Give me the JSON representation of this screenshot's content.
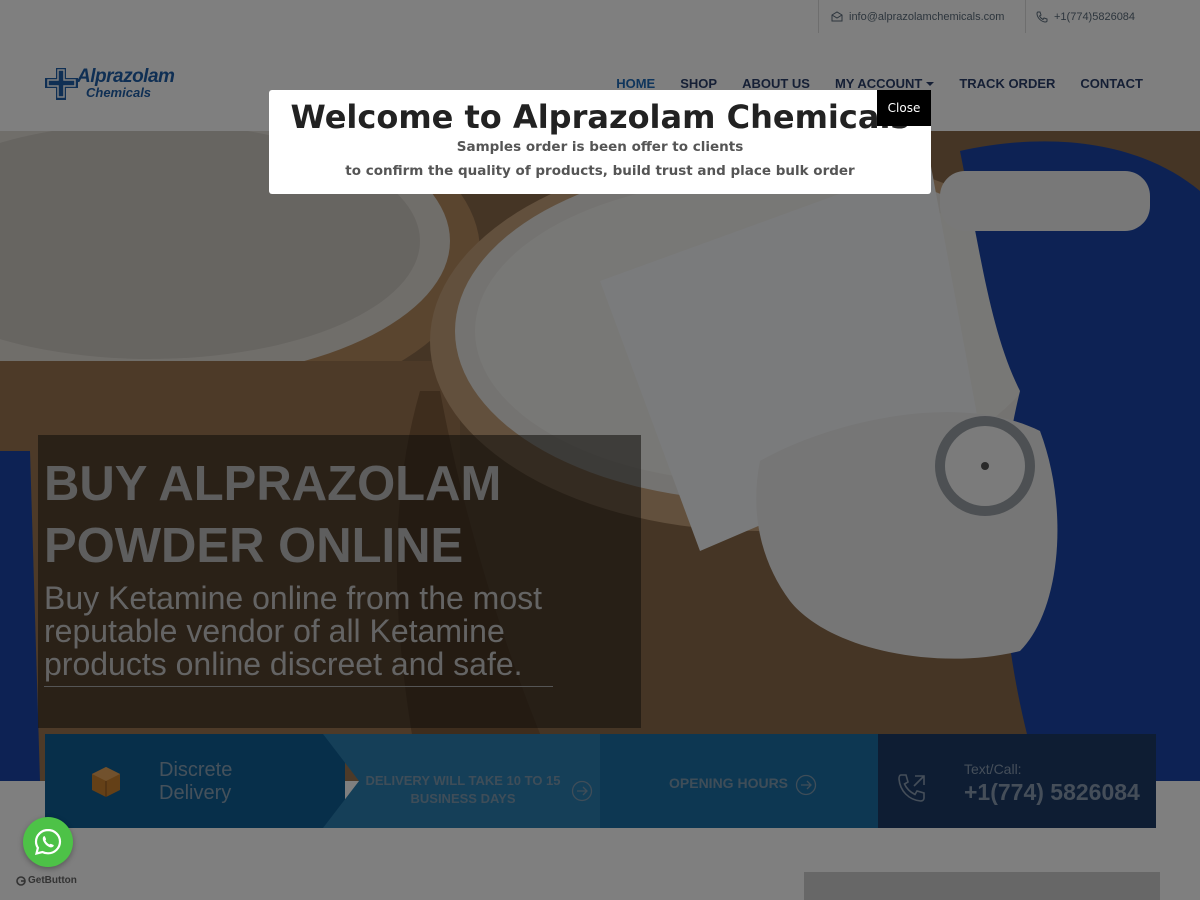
{
  "topbar": {
    "email": "info@alprazolamchemicals.com",
    "phone": "+1(774)5826084"
  },
  "logo": {
    "line1": "Alprazolam",
    "line2": "Chemicals"
  },
  "nav": {
    "items": [
      {
        "label": "HOME",
        "active": true
      },
      {
        "label": "SHOP"
      },
      {
        "label": "ABOUT US"
      },
      {
        "label": "MY ACCOUNT",
        "dropdown": true
      },
      {
        "label": "TRACK ORDER"
      },
      {
        "label": "CONTACT"
      }
    ]
  },
  "hero": {
    "title": "BUY ALPRAZOLAM POWDER ONLINE",
    "subtitle": "Buy Ketamine online from the most reputable vendor of all Ketamine products online discreet and safe."
  },
  "info": {
    "discrete": "Discrete Delivery",
    "delivery": "DELIVERY WILL TAKE 10 TO 15 BUSINESS DAYS",
    "hours": "OPENING HOURS",
    "call_label": "Text/Call:",
    "call_number": "+1(774) 5826084"
  },
  "modal": {
    "title": "Welcome to Alprazolam Chemicals",
    "line1": "Samples order is been offer to clients",
    "line2": "to confirm the quality of products, build trust and place bulk order",
    "close": "Close"
  },
  "widget": {
    "getbutton": "GetButton"
  },
  "colors": {
    "brand": "#1f5fa8",
    "nav": "#2b3f6b",
    "strip_dark": "#1c3a67",
    "strip_blue": "#0f5f94",
    "whatsapp": "#4dc247"
  }
}
